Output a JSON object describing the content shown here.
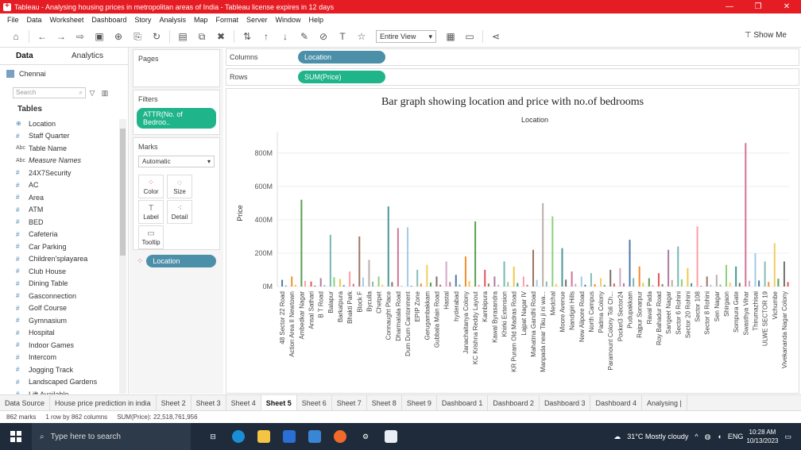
{
  "window": {
    "title": "Tableau - Analysing housing prices in metropolitan areas of India - Tableau license expires in 12 days",
    "controls": [
      "—",
      "❐",
      "✕"
    ]
  },
  "menu": [
    "File",
    "Data",
    "Worksheet",
    "Dashboard",
    "Story",
    "Analysis",
    "Map",
    "Format",
    "Server",
    "Window",
    "Help"
  ],
  "toolbar": {
    "view_mode": "Entire View",
    "show_me": "Show Me"
  },
  "data_pane": {
    "tabs": [
      "Data",
      "Analytics"
    ],
    "data_source": "Chennai",
    "search_placeholder": "Search",
    "tables_label": "Tables",
    "fields": [
      {
        "name": "Location",
        "type": "geo"
      },
      {
        "name": "Staff Quarter",
        "type": "#"
      },
      {
        "name": "Table Name",
        "type": "Abc"
      },
      {
        "name": "Measure Names",
        "type": "Abc"
      },
      {
        "name": "24X7Security",
        "type": "#"
      },
      {
        "name": "AC",
        "type": "#"
      },
      {
        "name": "Area",
        "type": "#"
      },
      {
        "name": "ATM",
        "type": "#"
      },
      {
        "name": "BED",
        "type": "#"
      },
      {
        "name": "Cafeteria",
        "type": "#"
      },
      {
        "name": "Car Parking",
        "type": "#"
      },
      {
        "name": "Children'splayarea",
        "type": "#"
      },
      {
        "name": "Club House",
        "type": "#"
      },
      {
        "name": "Dining Table",
        "type": "#"
      },
      {
        "name": "Gasconnection",
        "type": "#"
      },
      {
        "name": "Golf Course",
        "type": "#"
      },
      {
        "name": "Gymnasium",
        "type": "#"
      },
      {
        "name": "Hospital",
        "type": "#"
      },
      {
        "name": "Indoor Games",
        "type": "#"
      },
      {
        "name": "Intercom",
        "type": "#"
      },
      {
        "name": "Jogging Track",
        "type": "#"
      },
      {
        "name": "Landscaped Gardens",
        "type": "#"
      },
      {
        "name": "Lift Available",
        "type": "#"
      }
    ]
  },
  "cards": {
    "pages": "Pages",
    "filters": "Filters",
    "filter_pill": "ATTR(No. of Bedroo..",
    "marks": "Marks",
    "mark_type": "Automatic",
    "mark_buttons": [
      "Color",
      "Size",
      "Label",
      "Detail",
      "Tooltip"
    ],
    "marks_pill": "Location"
  },
  "shelves": {
    "columns_label": "Columns",
    "columns_pill": "Location",
    "rows_label": "Rows",
    "rows_pill": "SUM(Price)"
  },
  "chart_data": {
    "type": "bar",
    "title": "Bar graph showing location and price with no.of bedrooms",
    "subtitle": "Location",
    "xlabel": "Location",
    "ylabel": "Price",
    "yticks": [
      "0M",
      "200M",
      "400M",
      "600M",
      "800M"
    ],
    "ylim": [
      0,
      880
    ],
    "categories": [
      "48 Sector 22 Road",
      "Action Area II Newtown",
      "Ambedkar Nagar",
      "Ansal Sathari",
      "B T Road",
      "Balapur",
      "Barkatpura",
      "Bhakti Park",
      "Block F",
      "Byculla",
      "Chetpet",
      "Connaught Place",
      "Dharmatala Road",
      "Dum Dum Cantonment",
      "EPIP Zone",
      "Gerugambakkam",
      "Gubbala Main Road",
      "Hastal",
      "hyderabad",
      "Janachaitanya Colony",
      "KC Krishna Reddy Layout",
      "Kambipura",
      "Kawal Byrasandra",
      "Khirki Extension",
      "KR Puram Old Madras Road",
      "Lajpat Nagar IV",
      "Mahatma Gandhi Road",
      "Manpada near Tiku ji ni wa...",
      "Medchal",
      "Moore Avenue",
      "Nandigiri Hills",
      "New Alipore Road",
      "North Campus",
      "Padma Colony",
      "Paramount Colony Toli Ch...",
      "Pocket3 Sector24",
      "Pudupakkam",
      "Rajpur Sonarpur",
      "Raval Pada",
      "Roy Bahadur Road",
      "Sangeet Nagar",
      "Sector 6 Rohini",
      "Sector 20 Rohini",
      "Sector 108",
      "Sector 8 Rohini",
      "Sen Nagar",
      "Shirgaon",
      "Sompura Gate",
      "Swasthya Vihar",
      "Thirumazhisai",
      "ULWE SECTOR 19",
      "Vichumbe",
      "Vivekananda Nagar Colony"
    ],
    "values": [
      40,
      60,
      520,
      30,
      50,
      310,
      45,
      90,
      300,
      160,
      60,
      480,
      350,
      355,
      100,
      130,
      60,
      150,
      70,
      180,
      390,
      100,
      60,
      150,
      120,
      60,
      220,
      500,
      420,
      230,
      90,
      60,
      80,
      50,
      100,
      110,
      280,
      120,
      50,
      80,
      220,
      240,
      110,
      360,
      60,
      70,
      130,
      120,
      860,
      200,
      150,
      260,
      150
    ],
    "colors": [
      "#4e79a7",
      "#f28e2b",
      "#59a14f",
      "#e15759",
      "#b07aa1",
      "#76b7b2",
      "#edc948",
      "#ff9da7",
      "#9c755f",
      "#bab0ac",
      "#8cd17d",
      "#499894",
      "#d37295",
      "#a0cbe8",
      "#86bcb6",
      "#f1ce63",
      "#79706e",
      "#d4a6c8"
    ]
  },
  "sheet_tabs": [
    "Data Source",
    "House price prediction in india",
    "Sheet 2",
    "Sheet 3",
    "Sheet 4",
    "Sheet 5",
    "Sheet 6",
    "Sheet 7",
    "Sheet 8",
    "Sheet 9",
    "Dashboard 1",
    "Dashboard 2",
    "Dashboard 3",
    "Dashboard 4",
    "Analysing |"
  ],
  "active_sheet": "Sheet 5",
  "status": {
    "marks": "862 marks",
    "rows_cols": "1 row by 862 columns",
    "sum": "SUM(Price): 22,518,761,956"
  },
  "taskbar": {
    "search_placeholder": "Type here to search",
    "weather": "31°C  Mostly cloudy",
    "lang": "ENG",
    "time": "10:28 AM",
    "date": "10/13/2023"
  }
}
